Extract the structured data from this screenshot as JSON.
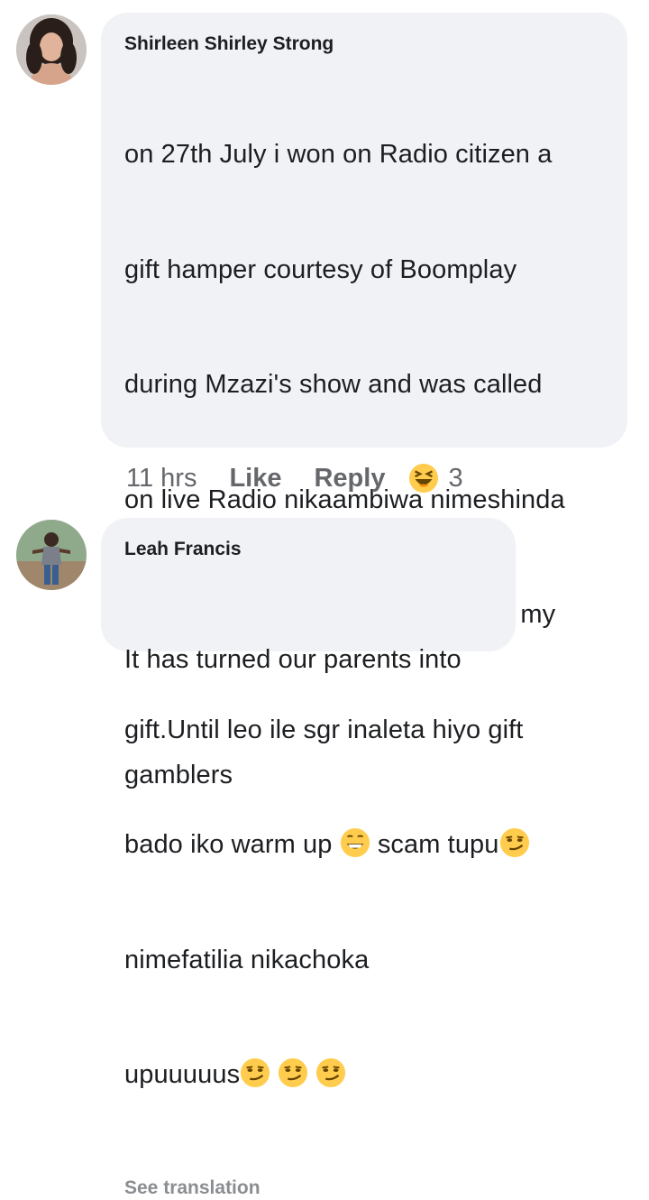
{
  "comments": [
    {
      "author": "Shirleen Shirley Strong",
      "lines": [
        "on 27th July i won on Radio citizen a",
        "gift hamper courtesy of Boomplay",
        "during Mzazi's show and was called",
        "on live Radio nikaambiwa nimeshinda",
        "nitapigiwa nielekezwe how I'd get my",
        "gift.Until leo ile sgr inaleta hiyo gift"
      ],
      "line7_a": "bado iko warm up ",
      "line7_b": " scam tupu",
      "line8": "nimefatilia nikachoka",
      "line9": "upuuuuus",
      "translate_label": "See translation",
      "time": "11 hrs",
      "like_label": "Like",
      "reply_label": "Reply",
      "reaction_count": "3",
      "emojis": [
        "grinning-face-icon",
        "smirking-face-icon",
        "laughing-squinting-face-icon"
      ]
    },
    {
      "author": "Leah Francis",
      "lines": [
        "It has turned our parents into",
        "gamblers"
      ]
    }
  ],
  "colors": {
    "bubble": "#f0f2f5",
    "text": "#1c1e21",
    "meta": "#65676b",
    "translate": "#8a8d91",
    "emoji_yellow": "#ffcc4d"
  }
}
